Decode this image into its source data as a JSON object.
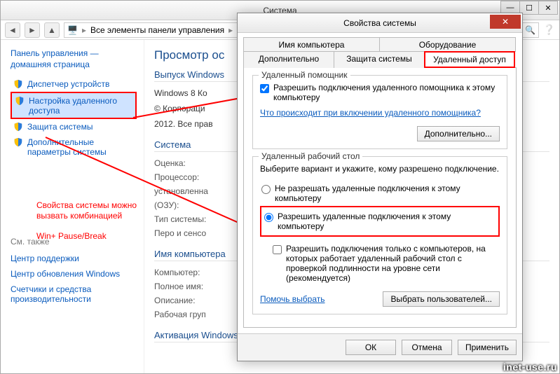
{
  "window": {
    "title": "Система"
  },
  "breadcrumb": {
    "text": "Все элементы панели управления",
    "arrow": "▸"
  },
  "nav": {
    "heading": "Панель управления —",
    "home": "домашняя страница",
    "items": [
      "Диспетчер устройств",
      "Настройка удаленного доступа",
      "Защита системы",
      "Дополнительные параметры системы"
    ],
    "see_also": "См. также",
    "see_links": [
      "Центр поддержки",
      "Центр обновления Windows",
      "Счетчики и средства производительности"
    ]
  },
  "content": {
    "heading": "Просмотр ос",
    "edition_title": "Выпуск Windows",
    "edition_name": "Windows 8 Ко",
    "copyright1": "© Корпораци",
    "copyright2": "2012. Все прав",
    "sys_title": "Система",
    "rows": {
      "rating": "Оценка:",
      "cpu": "Процессор:",
      "cpu_val": "установленна",
      "ram": "(ОЗУ):",
      "type": "Тип системы:",
      "pen": "Перо и сенсо",
      "compname_title": "Имя компьютера",
      "computer": "Компьютер:",
      "fullname": "Полное имя:",
      "desc": "Описание:",
      "workgroup": "Рабочая груп",
      "activation": "Активация Windows"
    }
  },
  "annot": {
    "line1": "Свойства системы можно",
    "line2": "вызвать комбинацией",
    "line3": "Win+ Pause/Break"
  },
  "dialog": {
    "title": "Свойства системы",
    "tabs": {
      "name": "Имя компьютера",
      "hardware": "Оборудование",
      "advanced": "Дополнительно",
      "protection": "Защита системы",
      "remote": "Удаленный доступ"
    },
    "ra_group": "Удаленный помощник",
    "ra_check": "Разрешить подключения удаленного помощника к этому компьютеру",
    "ra_link": "Что происходит при включении удаленного помощника?",
    "ra_btn": "Дополнительно...",
    "rd_group": "Удаленный рабочий стол",
    "rd_intro": "Выберите вариант и укажите, кому разрешено подключение.",
    "rd_radio1": "Не разрешать удаленные подключения к этому компьютеру",
    "rd_radio2": "Разрешить удаленные подключения к этому компьютеру",
    "rd_check": "Разрешить подключения только с компьютеров, на которых работает удаленный рабочий стол с проверкой подлинности на уровне сети (рекомендуется)",
    "rd_help": "Помочь выбрать",
    "rd_users_btn": "Выбрать пользователей...",
    "ok": "ОК",
    "cancel": "Отмена",
    "apply": "Применить"
  },
  "watermark": "inet-use.ru"
}
